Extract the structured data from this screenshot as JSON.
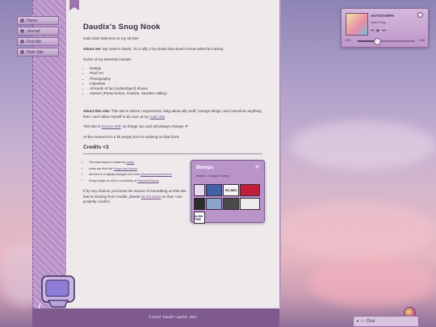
{
  "colors": {
    "accent": "#b48fc4",
    "dark_accent": "#7e5a8f",
    "paper": "#eeeaec",
    "text": "#3b3040"
  },
  "nav": {
    "items": [
      {
        "label": "Home",
        "icon": "home-icon"
      },
      {
        "label": "Journal",
        "icon": "journal-icon"
      },
      {
        "label": "Find Me",
        "icon": "find-icon"
      },
      {
        "label": "Main Site",
        "icon": "globe-icon"
      }
    ]
  },
  "page": {
    "title": "Daudix's Snug Nook",
    "greeting": "Haiii x333 Welcome to my all site!",
    "about_me_label": "About me:",
    "about_me_text": "My name's David, I'm a silly 17yo dude that doesn't know what he's doing.",
    "interests_intro": "Some of my interests include:",
    "interests": [
      "Design",
      "Pixel Art",
      "Photography",
      "IndieWeb",
      "All kinds of fun (indie/object) shows",
      "Games (Portal series, Celeste, Stardew Valley)"
    ],
    "about_site_label": "About this site:",
    "about_site_text": "This site is where I experiment, blog about silly stuff, change things, and overall do anything that I can't allow myself to do over at my",
    "about_site_link": "main site",
    "wip_pre": "This site is",
    "wip_link": "forever WiP",
    "wip_post": ", so things can and will always change :P",
    "moment_text": "At the moment it's a bit empty but I'm working on that front.",
    "credits_heading": "Credits <3",
    "credits": [
      {
        "text": "The base layout is made by",
        "link": "sadgrl"
      },
      {
        "text": "Icons are from the",
        "link": "Tango icon theme"
      },
      {
        "text": "404 text is a slightly changed one from",
        "link": "jalapeñobumperstickers"
      },
      {
        "text": "Derpy image on 404 is a courtesy of",
        "link": "RainbowPlasma"
      }
    ],
    "credits_note_pre": "If by any chance you know the source of something on this site that is missing from credits, please",
    "credits_note_link": "let me know",
    "credits_note_post": "so that I can properly credit it."
  },
  "bumps": {
    "title": "Bumps",
    "breadcrumb": "Buttons > Images > Bumps",
    "items": [
      {
        "text": "",
        "bg": "#e7d9ef",
        "fg": "#3a2a40"
      },
      {
        "text": "",
        "bg": "#3f63a6",
        "fg": "#ffffff"
      },
      {
        "text": "ISO 8601",
        "bg": "#f3f3f3",
        "fg": "#111111"
      },
      {
        "text": "",
        "bg": "#c21e3a",
        "fg": "#ffffff"
      },
      {
        "text": "",
        "bg": "#2b2b2b",
        "fg": "#ffffff"
      },
      {
        "text": "",
        "bg": "#8aa4c8",
        "fg": "#ffffff"
      },
      {
        "text": "",
        "bg": "#4a4a4a",
        "fg": "#ffffff"
      },
      {
        "text": "",
        "bg": "#ececec",
        "fg": "#222222"
      },
      {
        "text": "ALWA TIRE",
        "bg": "#fafafa",
        "fg": "#1d1d5a"
      }
    ]
  },
  "player": {
    "artist": "ANTONYMPH",
    "song": "Vylet Pony",
    "time_current": "1:22",
    "time_total": "4:08",
    "progress": 0.33
  },
  "footer": {
    "text": "© David \"Daudix\" Lapshin, 2024"
  },
  "chat": {
    "label": "Chat"
  }
}
